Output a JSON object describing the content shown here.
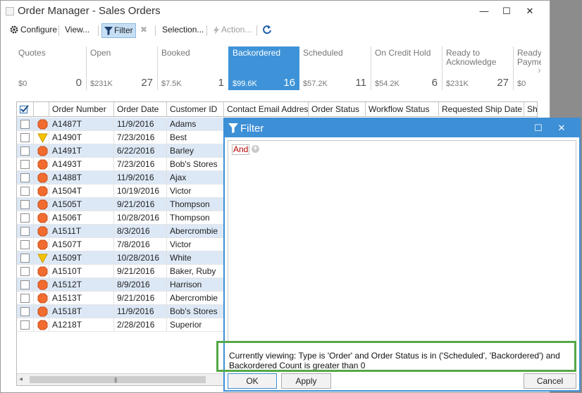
{
  "window": {
    "title": "Order Manager - Sales Orders",
    "minimize": "—",
    "maximize": "☐",
    "close": "✕"
  },
  "toolbar": {
    "configure": "Configure",
    "view": "View...",
    "filter": "Filter",
    "selection": "Selection...",
    "action": "Action...",
    "clear_icon": "✖"
  },
  "tiles": [
    {
      "label": "Quotes",
      "amount": "$0",
      "count": "0"
    },
    {
      "label": "Open",
      "amount": "$231K",
      "count": "27"
    },
    {
      "label": "Booked",
      "amount": "$7.5K",
      "count": "1"
    },
    {
      "label": "Backordered",
      "amount": "$99.6K",
      "count": "16"
    },
    {
      "label": "Scheduled",
      "amount": "$57.2K",
      "count": "11"
    },
    {
      "label": "On Credit Hold",
      "amount": "$54.2K",
      "count": "6"
    },
    {
      "label": "Ready to Acknowledge",
      "amount": "$231K",
      "count": "27"
    },
    {
      "label": "Ready Payme",
      "amount": "$0",
      "count": ""
    }
  ],
  "tiles_next": "›",
  "grid": {
    "columns": [
      "Order Number",
      "Order Date",
      "Customer ID",
      "Contact Email Address",
      "Order Status",
      "Workflow Status",
      "Requested Ship Date",
      "Sh"
    ],
    "rows": [
      {
        "shape": "hex",
        "order": "A1487T",
        "date": "11/9/2016",
        "customer": "Adams"
      },
      {
        "shape": "tri",
        "order": "A1490T",
        "date": "7/23/2016",
        "customer": "Best"
      },
      {
        "shape": "hex",
        "order": "A1491T",
        "date": "6/22/2016",
        "customer": "Barley"
      },
      {
        "shape": "hex",
        "order": "A1493T",
        "date": "7/23/2016",
        "customer": "Bob's Stores"
      },
      {
        "shape": "hex",
        "order": "A1488T",
        "date": "11/9/2016",
        "customer": "Ajax"
      },
      {
        "shape": "hex",
        "order": "A1504T",
        "date": "10/19/2016",
        "customer": "Victor"
      },
      {
        "shape": "hex",
        "order": "A1505T",
        "date": "9/21/2016",
        "customer": "Thompson"
      },
      {
        "shape": "hex",
        "order": "A1506T",
        "date": "10/28/2016",
        "customer": "Thompson"
      },
      {
        "shape": "hex",
        "order": "A1511T",
        "date": "8/3/2016",
        "customer": "Abercrombie"
      },
      {
        "shape": "hex",
        "order": "A1507T",
        "date": "7/8/2016",
        "customer": "Victor"
      },
      {
        "shape": "tri",
        "order": "A1509T",
        "date": "10/28/2016",
        "customer": "White"
      },
      {
        "shape": "hex",
        "order": "A1510T",
        "date": "9/21/2016",
        "customer": "Baker, Ruby"
      },
      {
        "shape": "hex",
        "order": "A1512T",
        "date": "8/9/2016",
        "customer": "Harrison"
      },
      {
        "shape": "hex",
        "order": "A1513T",
        "date": "9/21/2016",
        "customer": "Abercrombie"
      },
      {
        "shape": "hex",
        "order": "A1518T",
        "date": "11/9/2016",
        "customer": "Bob's Stores"
      },
      {
        "shape": "hex",
        "order": "A1218T",
        "date": "2/28/2016",
        "customer": "Superior"
      }
    ],
    "scroll_left": "◂",
    "scroll_grip": "|||"
  },
  "filter": {
    "title": "Filter",
    "maximize": "☐",
    "close": "✕",
    "group_operator": "And",
    "add_condition": "+",
    "description": "Currently viewing: Type is 'Order' and Order Status is in ('Scheduled', 'Backordered') and Backordered Count is greater than 0",
    "ok": "OK",
    "apply": "Apply",
    "cancel": "Cancel"
  },
  "colors": {
    "accent": "#3d8fd6",
    "selected_tile": "#3e93d8",
    "row_alt": "#dde8f6",
    "highlight": "#56a846",
    "hex_icon": "#f26b2f",
    "tri_icon": "#f5c400"
  }
}
